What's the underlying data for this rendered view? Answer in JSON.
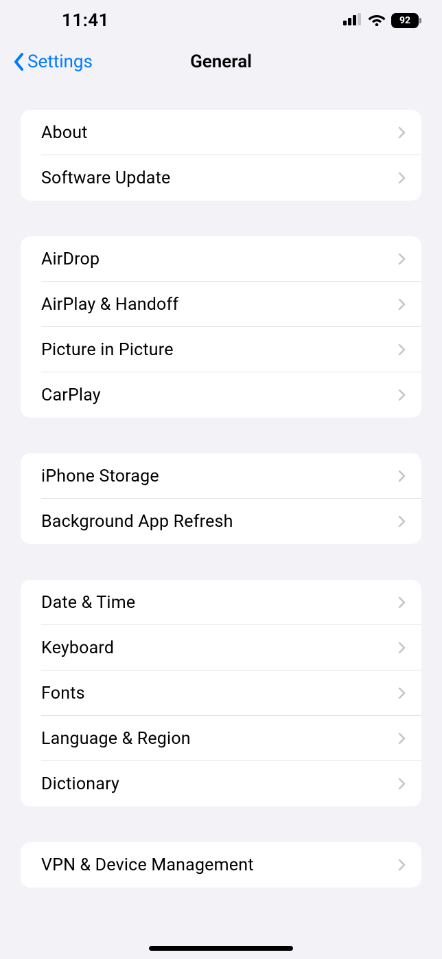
{
  "status": {
    "time": "11:41",
    "battery": "92"
  },
  "nav": {
    "back": "Settings",
    "title": "General"
  },
  "groups": [
    {
      "rows": [
        {
          "key": "about",
          "label": "About"
        },
        {
          "key": "software-update",
          "label": "Software Update"
        }
      ]
    },
    {
      "rows": [
        {
          "key": "airdrop",
          "label": "AirDrop"
        },
        {
          "key": "airplay-handoff",
          "label": "AirPlay & Handoff"
        },
        {
          "key": "picture-in-picture",
          "label": "Picture in Picture"
        },
        {
          "key": "carplay",
          "label": "CarPlay"
        }
      ]
    },
    {
      "rows": [
        {
          "key": "iphone-storage",
          "label": "iPhone Storage"
        },
        {
          "key": "background-app-refresh",
          "label": "Background App Refresh"
        }
      ]
    },
    {
      "rows": [
        {
          "key": "date-time",
          "label": "Date & Time"
        },
        {
          "key": "keyboard",
          "label": "Keyboard"
        },
        {
          "key": "fonts",
          "label": "Fonts"
        },
        {
          "key": "language-region",
          "label": "Language & Region"
        },
        {
          "key": "dictionary",
          "label": "Dictionary"
        }
      ]
    },
    {
      "rows": [
        {
          "key": "vpn-device-management",
          "label": "VPN & Device Management"
        }
      ]
    }
  ]
}
